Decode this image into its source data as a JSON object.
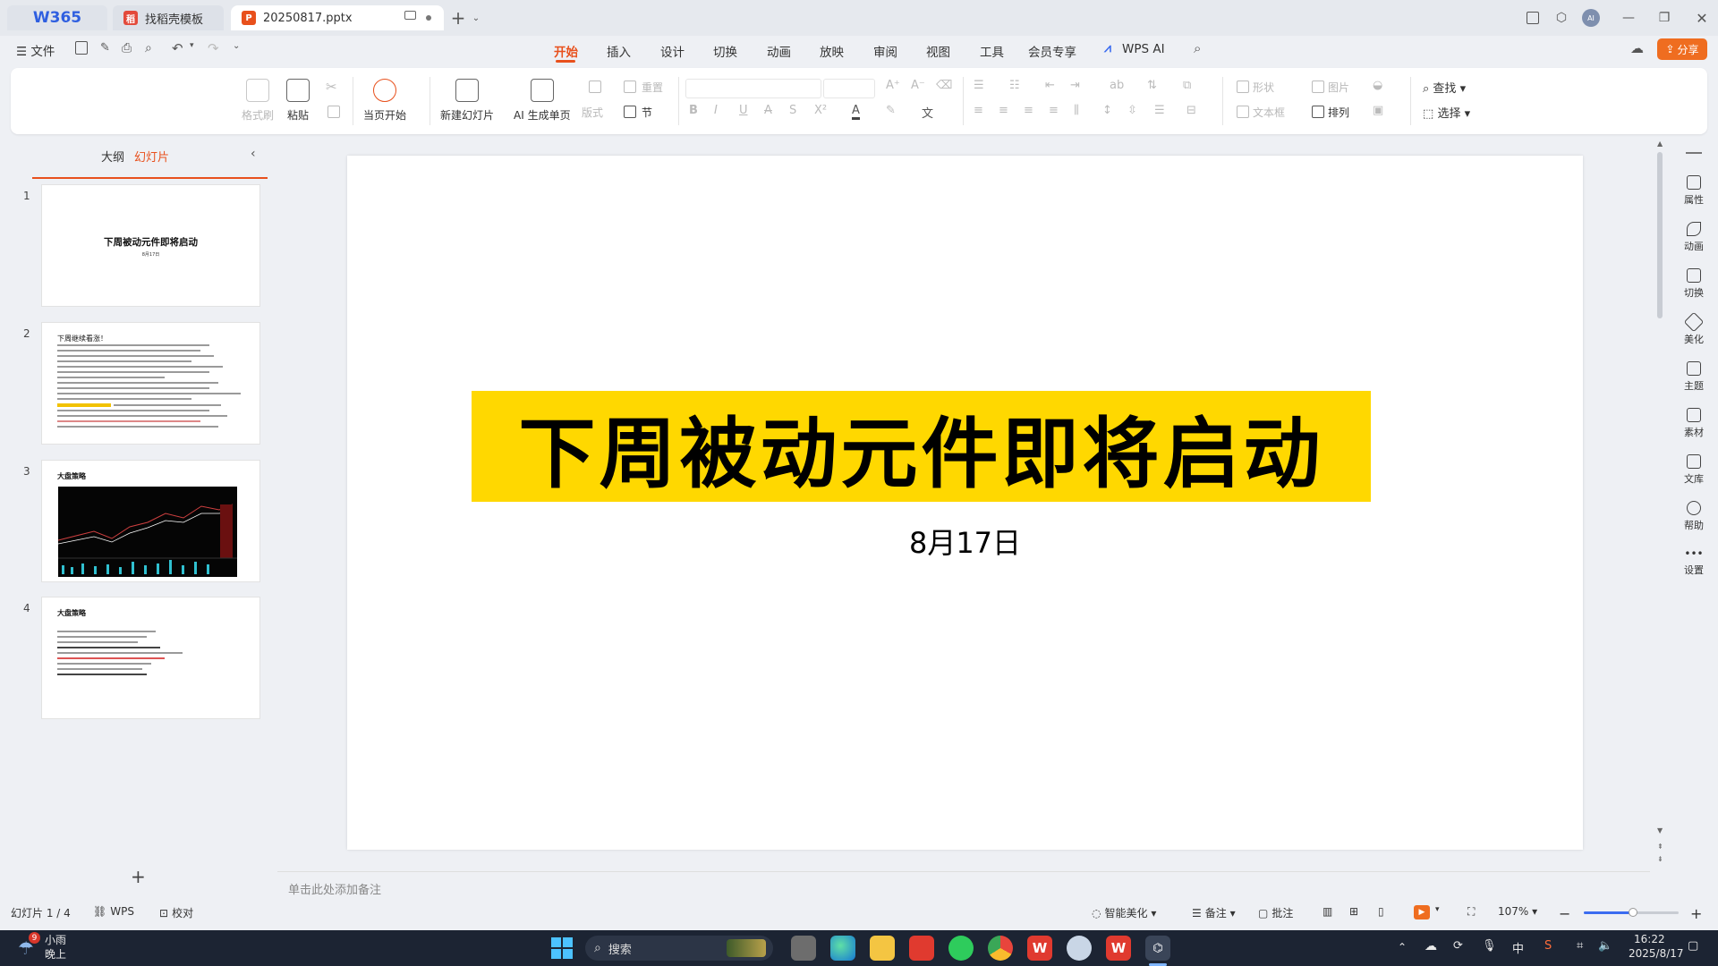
{
  "titlebar": {
    "home_tab": "W365",
    "tab_template": "找稻壳模板",
    "tab_file": "20250817.pptx"
  },
  "menu": {
    "file": "文件",
    "items": [
      "开始",
      "插入",
      "设计",
      "切换",
      "动画",
      "放映",
      "审阅",
      "视图",
      "工具",
      "会员专享",
      "WPS AI"
    ],
    "share": "分享"
  },
  "ribbon": {
    "format_painter": "格式刷",
    "paste": "粘贴",
    "play_current": "当页开始",
    "new_slide": "新建幻灯片",
    "ai_page": "AI 生成单页",
    "layout": "版式",
    "section": "节",
    "reset": "重置",
    "shape": "形状",
    "picture": "图片",
    "textbox": "文本框",
    "arrange": "排列",
    "find": "查找",
    "select": "选择"
  },
  "panel": {
    "tab_outline": "大纲",
    "tab_slides": "幻灯片",
    "slides": [
      {
        "num": "1",
        "title": "下周被动元件即将启动",
        "sub": "8月17日"
      },
      {
        "num": "2",
        "title": "下周继续看涨！"
      },
      {
        "num": "3",
        "title": "大盘策略"
      },
      {
        "num": "4",
        "title": "大盘策略"
      }
    ]
  },
  "slide": {
    "title": "下周被动元件即将启动",
    "subtitle": "8月17日",
    "title_bg": "#ffd800"
  },
  "notes_placeholder": "单击此处添加备注",
  "sidebar": [
    "属性",
    "动画",
    "切换",
    "美化",
    "主题",
    "素材",
    "文库",
    "帮助",
    "设置"
  ],
  "status": {
    "slide_counter": "幻灯片 1 / 4",
    "wps": "WPS",
    "proof": "校对",
    "smart_beautify": "智能美化",
    "notes": "备注",
    "comments": "批注",
    "zoom": "107%",
    "zoom_fraction": 0.52
  },
  "taskbar": {
    "weather_temp": "小雨",
    "weather_time": "晚上",
    "weather_badge": "9",
    "search": "搜索",
    "ime": "中",
    "time": "16:22",
    "date": "2025/8/17"
  },
  "colors": {
    "accent": "#e8501c",
    "brand_blue": "#2f5fe0"
  }
}
